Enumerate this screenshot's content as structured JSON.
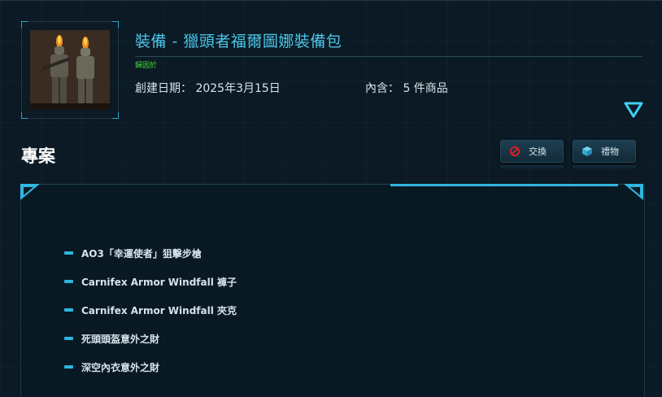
{
  "package": {
    "title": "裝備 - 獵頭者福爾圖娜裝備包",
    "owner_tag": "歸因於",
    "created_label": "創建日期： 2025年3月15日",
    "contains_label": "內含： 5 件商品"
  },
  "section": {
    "title": "專案"
  },
  "actions": {
    "trade_label": "交換",
    "gift_label": "禮物"
  },
  "items": [
    "AO3「幸運使者」狙擊步槍",
    "Carnifex Armor Windfall 褲子",
    "Carnifex Armor Windfall 夾克",
    "死頭頭盔意外之財",
    "深空內衣意外之財"
  ],
  "icons": {
    "expand": "chevron-down-icon",
    "trade": "no-entry-icon",
    "gift": "cube-icon"
  },
  "colors": {
    "accent": "#4cc4e8",
    "owner": "#4ade3a",
    "background": "#0b1a24",
    "trade_icon": "#e0202a"
  }
}
